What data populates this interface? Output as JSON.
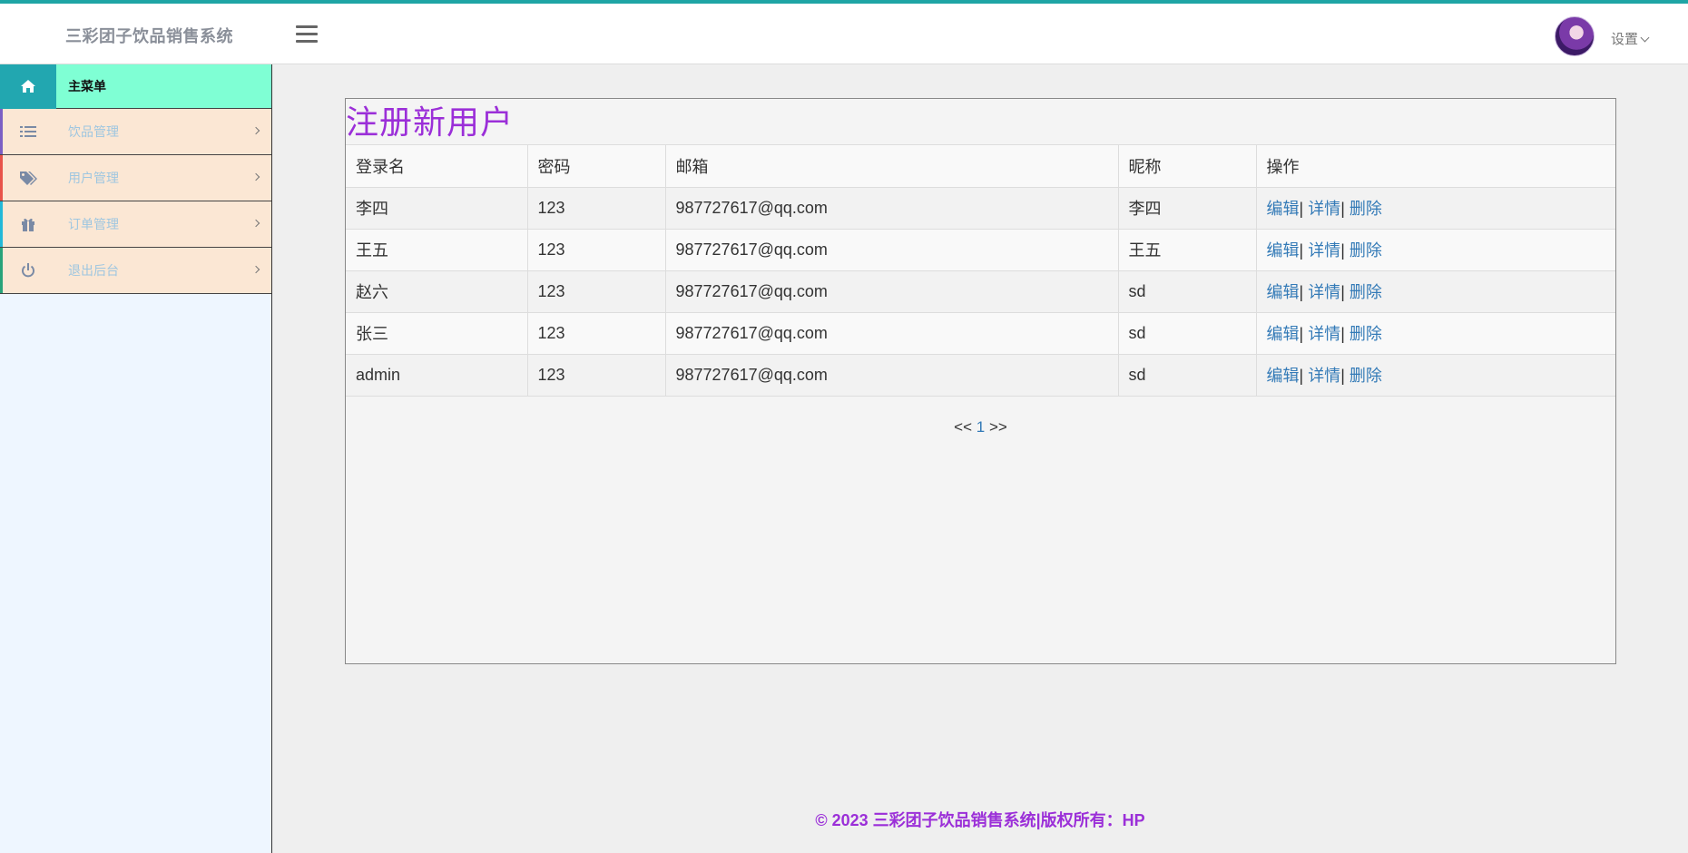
{
  "header": {
    "brand": "三彩团子饮品销售系统",
    "settings_label": "设置"
  },
  "sidebar": {
    "main_label": "主菜单",
    "items": [
      {
        "label": "饮品管理",
        "icon": "list-icon",
        "accent": "#7b5fc4"
      },
      {
        "label": "用户管理",
        "icon": "tags-icon",
        "accent": "#e8534a"
      },
      {
        "label": "订单管理",
        "icon": "gift-icon",
        "accent": "#22b8d8"
      },
      {
        "label": "退出后台",
        "icon": "power-icon",
        "accent": "#27a37a"
      }
    ]
  },
  "panel": {
    "title": "注册新用户",
    "columns": [
      "登录名",
      "密码",
      "邮箱",
      "昵称",
      "操作"
    ],
    "rows": [
      {
        "login": "李四",
        "password": "123",
        "email": "987727617@qq.com",
        "nickname": "李四"
      },
      {
        "login": "王五",
        "password": "123",
        "email": "987727617@qq.com",
        "nickname": "王五"
      },
      {
        "login": "赵六",
        "password": "123",
        "email": "987727617@qq.com",
        "nickname": "sd"
      },
      {
        "login": "张三",
        "password": "123",
        "email": "987727617@qq.com",
        "nickname": "sd"
      },
      {
        "login": "admin",
        "password": "123",
        "email": "987727617@qq.com",
        "nickname": "sd"
      }
    ],
    "actions": {
      "edit": "编辑",
      "detail": "详情",
      "delete": "删除",
      "separator": "|"
    },
    "pager": {
      "prev": "<<",
      "page": "1",
      "next": ">>"
    }
  },
  "footer": "© 2023 三彩团子饮品销售系统|版权所有：HP",
  "colors": {
    "brand_teal": "#22a7b0",
    "menu_head_bg": "#7fffd4",
    "menu_item_bg": "#fbe7d4",
    "title_purple": "#9b2fd8",
    "link_blue": "#337ab7"
  }
}
